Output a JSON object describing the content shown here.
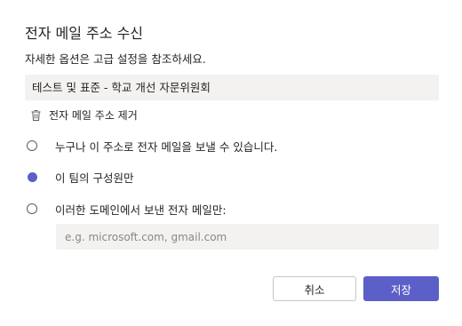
{
  "dialog": {
    "title": "전자 메일 주소 수신",
    "subtitle": "자세한 옵션은 고급 설정을 참조하세요.",
    "address_value": "테스트 및 표준 - 학교 개선 자문위원회",
    "remove_label": "전자 메일 주소 제거",
    "options": [
      {
        "label": "누구나 이 주소로 전자 메일을 보낼 수 있습니다.",
        "selected": false
      },
      {
        "label": "이 팀의 구성원만",
        "selected": true
      },
      {
        "label": "이러한 도메인에서 보낸 전자 메일만:",
        "selected": false
      }
    ],
    "domain_placeholder": "e.g. microsoft.com, gmail.com",
    "domain_value": "",
    "cancel_label": "취소",
    "save_label": "저장",
    "accent_color": "#5b5fc7",
    "icons": {
      "remove": "trash-icon"
    }
  }
}
